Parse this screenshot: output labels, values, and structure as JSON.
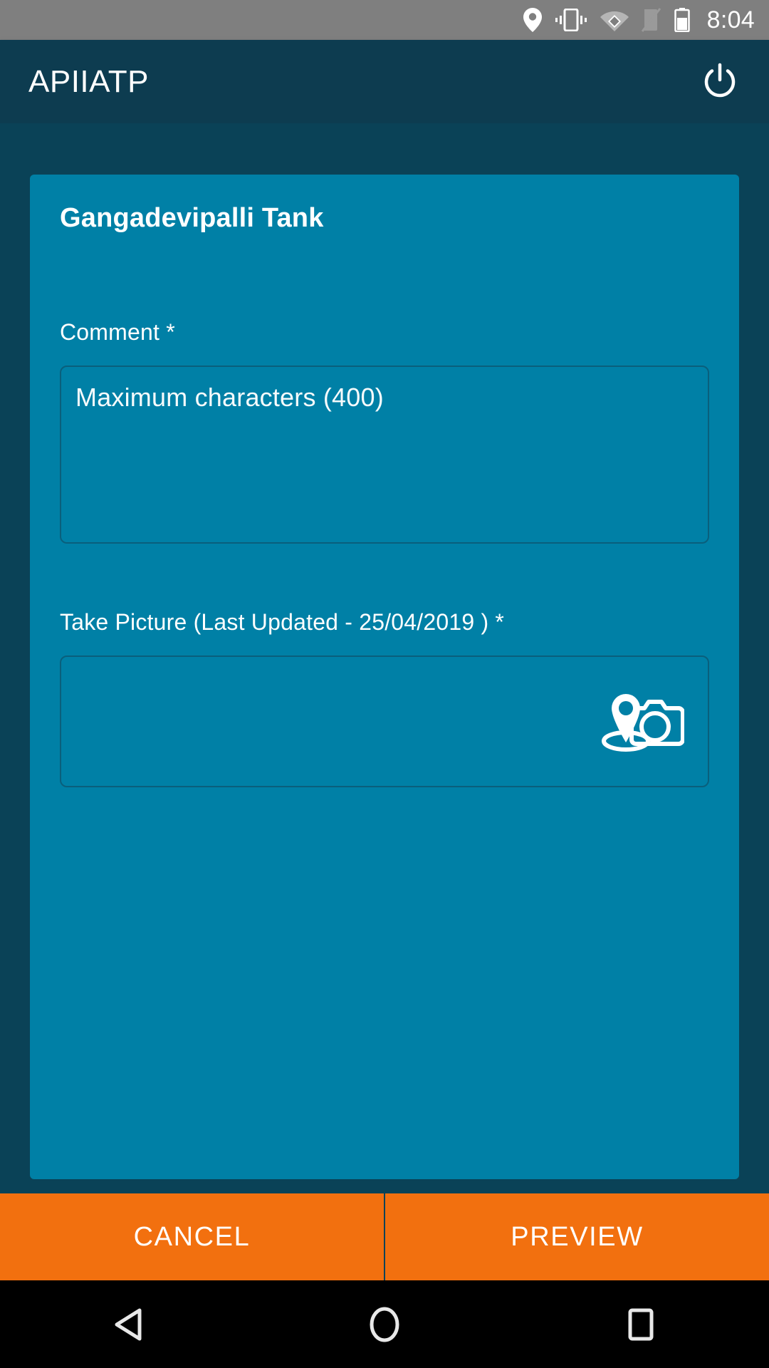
{
  "status_bar": {
    "time": "8:04",
    "icons": [
      "location-pin-icon",
      "vibrate-icon",
      "wifi-icon",
      "signal-off-icon",
      "battery-icon"
    ],
    "background_color": "#7f7f7f"
  },
  "app_bar": {
    "title": "APIIATP",
    "power_icon": "power-icon",
    "background_color": "#0d3c50"
  },
  "card": {
    "title": "Gangadevipalli Tank",
    "background_color": "#0080a6",
    "comment": {
      "label": "Comment *",
      "placeholder": "Maximum characters (400)",
      "value": ""
    },
    "take_picture": {
      "label": "Take Picture (Last Updated - 25/04/2019 ) *",
      "icon": "geo-camera-icon",
      "value": ""
    }
  },
  "actions": {
    "cancel_label": "CANCEL",
    "preview_label": "PREVIEW",
    "accent_color": "#f2700f"
  },
  "nav_bar": {
    "back_icon": "back-triangle-icon",
    "home_icon": "home-circle-icon",
    "recents_icon": "recents-square-icon",
    "background_color": "#000000"
  }
}
